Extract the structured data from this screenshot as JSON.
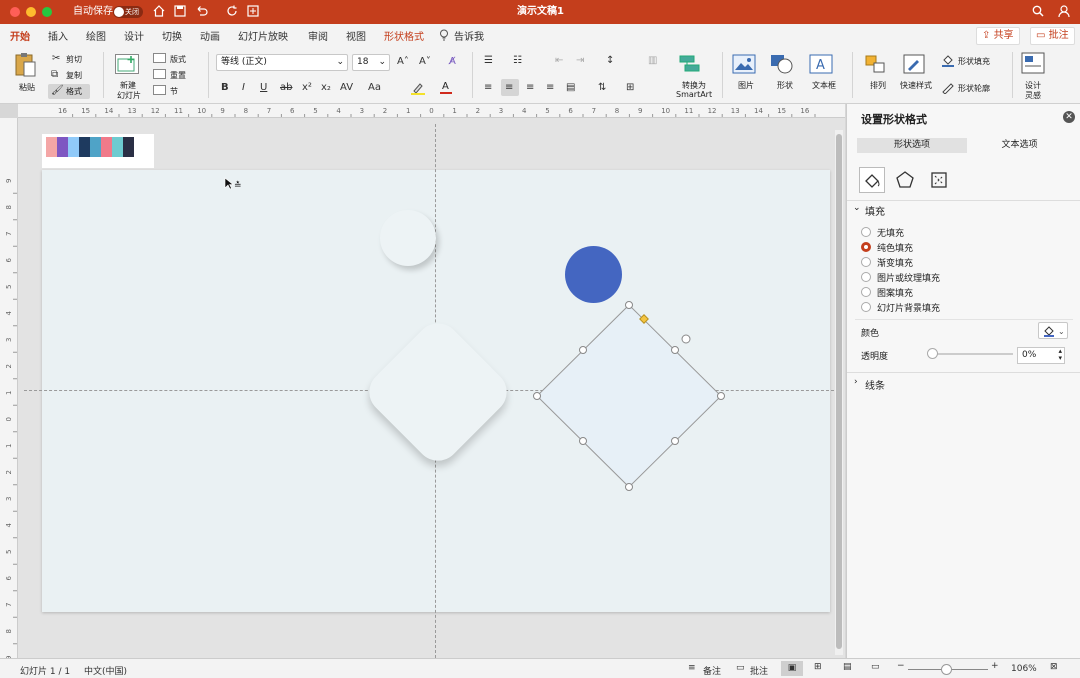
{
  "titlebar": {
    "autosave_label": "自动保存",
    "autosave_state": "关闭",
    "doc_title": "演示文稿1"
  },
  "tabs": [
    "开始",
    "插入",
    "绘图",
    "设计",
    "切换",
    "动画",
    "幻灯片放映",
    "审阅",
    "视图",
    "形状格式"
  ],
  "tell_me": "告诉我",
  "header_buttons": {
    "share": "共享",
    "comments": "批注"
  },
  "ribbon": {
    "paste": "粘贴",
    "cut": "剪切",
    "copy": "复制",
    "format": "格式",
    "new_slide_1": "新建",
    "new_slide_2": "幻灯片",
    "layout": "版式",
    "reset": "重置",
    "section": "节",
    "font_name": "等线 (正文)",
    "font_size": "18",
    "convert_1": "转换为",
    "convert_2": "SmartArt",
    "picture": "图片",
    "shape": "形状",
    "textbox": "文本框",
    "arrange": "排列",
    "quick_styles": "快速样式",
    "shape_fill": "形状填充",
    "shape_outline": "形状轮廓",
    "designer_1": "设计",
    "designer_2": "灵感"
  },
  "ruler_h_labels": [
    "16",
    "15",
    "14",
    "13",
    "12",
    "11",
    "10",
    "9",
    "8",
    "7",
    "6",
    "5",
    "4",
    "3",
    "2",
    "1",
    "0",
    "1",
    "2",
    "3",
    "4",
    "5",
    "6",
    "7",
    "8",
    "9",
    "10",
    "11",
    "12",
    "13",
    "14",
    "15",
    "16"
  ],
  "ruler_v_labels": [
    "9",
    "8",
    "7",
    "6",
    "5",
    "4",
    "3",
    "2",
    "1",
    "0",
    "1",
    "2",
    "3",
    "4",
    "5",
    "6",
    "7",
    "8",
    "9"
  ],
  "swatches": [
    "#f4a6a6",
    "#7e57c2",
    "#90caf9",
    "#1e3a5f",
    "#4fa3c7",
    "#f07a8a",
    "#6ecbd0",
    "#2a2f45"
  ],
  "colors": {
    "accent": "#c43e1c",
    "circle_blue": "#4466c1",
    "slide_bg": "#eaf1f3"
  },
  "panel": {
    "title": "设置形状格式",
    "tab_shape": "形状选项",
    "tab_text": "文本选项",
    "section_fill": "填充",
    "fill_options": [
      "无填充",
      "纯色填充",
      "渐变填充",
      "图片或纹理填充",
      "图案填充",
      "幻灯片背景填充"
    ],
    "selected_fill": "纯色填充",
    "color_label": "颜色",
    "transparency_label": "透明度",
    "transparency_value": "0%",
    "section_line": "线条"
  },
  "status": {
    "slide": "幻灯片 1 / 1",
    "language": "中文(中国)",
    "notes": "备注",
    "comments": "批注",
    "zoom": "106%"
  }
}
